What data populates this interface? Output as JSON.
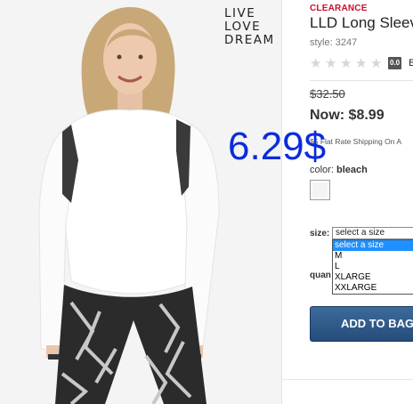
{
  "brand": {
    "lines": [
      "LIVE",
      "LOVE",
      "DREAM"
    ]
  },
  "product": {
    "badge": "CLEARANCE",
    "title": "LLD Long Sleev",
    "style": "style: 3247",
    "rating": {
      "stars": 0,
      "max": 5,
      "score_badge": "0.0",
      "link_text": "B"
    },
    "old_price": "$32.50",
    "now_price": "Now: $8.99",
    "shipping": "$5 Flat Rate Shipping On A",
    "color_label": "color:",
    "color_value": "bleach",
    "swatch_color": "#f4f4f4"
  },
  "size": {
    "label": "size:",
    "selected": "select a size",
    "options": [
      "select a size",
      "M",
      "L",
      "XLARGE",
      "XXLARGE"
    ],
    "highlighted_index": 0
  },
  "quantity": {
    "label": "quan"
  },
  "actions": {
    "add_to_bag": "ADD TO BAG"
  },
  "overlay": {
    "handwritten_price": "6.29$",
    "color": "#0a2bdc"
  }
}
